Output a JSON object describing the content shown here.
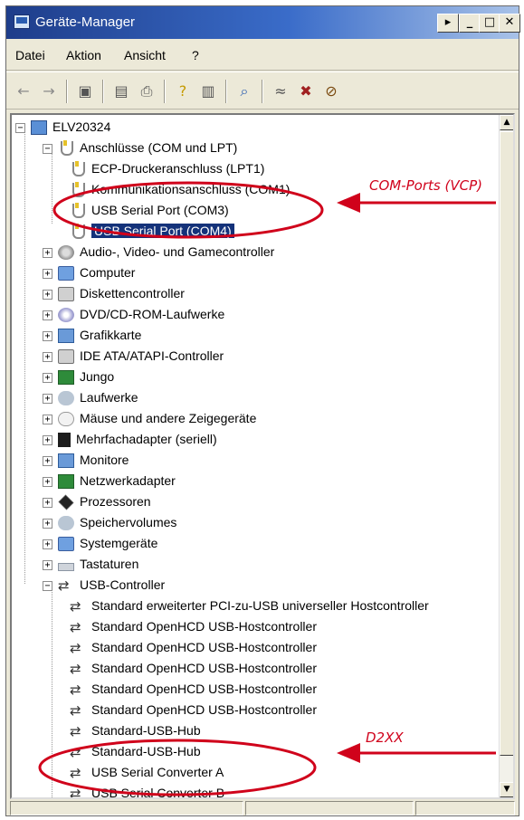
{
  "window": {
    "title": "Geräte-Manager",
    "controls": [
      "▸",
      "_",
      "□",
      "✕"
    ]
  },
  "menu": [
    "Datei",
    "Aktion",
    "Ansicht",
    "?"
  ],
  "toolbar": {
    "icons": [
      "back-arrow-icon",
      "forward-arrow-icon",
      "tree-view-icon",
      "properties-icon",
      "print-icon",
      "help-icon",
      "details-view-icon",
      "scan-hardware-icon",
      "update-driver-icon",
      "uninstall-icon",
      "disable-icon"
    ]
  },
  "tree": {
    "root": "ELV20324",
    "ports_group": "Anschlüsse (COM und LPT)",
    "ports": [
      "ECP-Druckeranschluss (LPT1)",
      "Kommunikationsanschluss (COM1)",
      "USB Serial Port (COM3)",
      "USB Serial Port (COM4)"
    ],
    "categories": [
      "Audio-, Video- und Gamecontroller",
      "Computer",
      "Diskettencontroller",
      "DVD/CD-ROM-Laufwerke",
      "Grafikkarte",
      "IDE ATA/ATAPI-Controller",
      "Jungo",
      "Laufwerke",
      "Mäuse und andere Zeigegeräte",
      "Mehrfachadapter (seriell)",
      "Monitore",
      "Netzwerkadapter",
      "Prozessoren",
      "Speichervolumes",
      "Systemgeräte",
      "Tastaturen"
    ],
    "usb_group": "USB-Controller",
    "usb_items": [
      "Standard erweiterter PCI-zu-USB universeller Hostcontroller",
      "Standard OpenHCD USB-Hostcontroller",
      "Standard OpenHCD USB-Hostcontroller",
      "Standard OpenHCD USB-Hostcontroller",
      "Standard OpenHCD USB-Hostcontroller",
      "Standard OpenHCD USB-Hostcontroller",
      "Standard-USB-Hub",
      "Standard-USB-Hub",
      "USB Serial Converter A",
      "USB Serial Converter B"
    ],
    "expand_open": "−",
    "expand_closed": "+"
  },
  "annotations": {
    "com_ports": "COM-Ports (VCP)",
    "d2xx": "D2XX",
    "color": "#d0021b"
  },
  "colors": {
    "title_bar_start": "#1e3d8a",
    "selection": "#14327a",
    "window_face": "#ece9d8"
  }
}
